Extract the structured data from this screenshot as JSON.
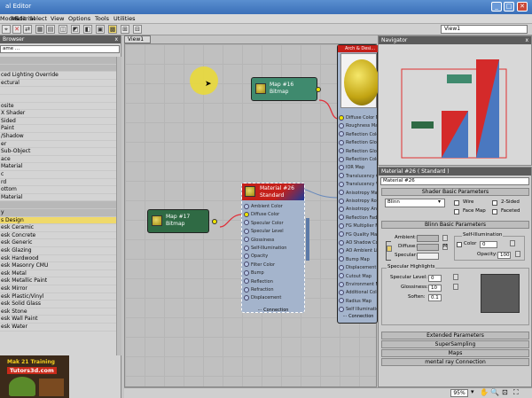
{
  "window": {
    "title": "al Editor",
    "min": "_",
    "max": "□",
    "close": "✕"
  },
  "menu": [
    "Modes",
    "Material",
    "Edit",
    "Select",
    "View",
    "Options",
    "Tools",
    "Utilities"
  ],
  "toolbar": {
    "view_select": "View1"
  },
  "browser": {
    "title": "Browser",
    "close": "x",
    "search": "ame ...",
    "items": [
      {
        "label": "",
        "group": true
      },
      {
        "label": "",
        "group": true
      },
      {
        "label": "ced Lighting Override",
        "group": false
      },
      {
        "label": "ectural",
        "group": false
      },
      {
        "label": "",
        "group": false
      },
      {
        "label": "",
        "group": false
      },
      {
        "label": "osite",
        "group": false
      },
      {
        "label": "X Shader",
        "group": false
      },
      {
        "label": "Sided",
        "group": false
      },
      {
        "label": "Paint",
        "group": false
      },
      {
        "label": "/Shadow",
        "group": false
      },
      {
        "label": "er",
        "group": false
      },
      {
        "label": "Sub-Object",
        "group": false
      },
      {
        "label": "ace",
        "group": false
      },
      {
        "label": "Material",
        "group": false
      },
      {
        "label": "c",
        "group": false
      },
      {
        "label": "rd",
        "group": false
      },
      {
        "label": "ottom",
        "group": false
      },
      {
        "label": "Material",
        "group": false
      },
      {
        "label": "",
        "group": true
      },
      {
        "label": "y",
        "group": true
      },
      {
        "label": "s Design",
        "selected": true
      },
      {
        "label": "esk Ceramic"
      },
      {
        "label": "esk Concrete"
      },
      {
        "label": "esk Generic"
      },
      {
        "label": "esk Glazing"
      },
      {
        "label": "esk Hardwood"
      },
      {
        "label": "esk Masonry CMU"
      },
      {
        "label": "esk Metal"
      },
      {
        "label": "esk Metallic Paint"
      },
      {
        "label": "esk Mirror"
      },
      {
        "label": "esk Plastic/Vinyl"
      },
      {
        "label": "esk Solid Glass"
      },
      {
        "label": "esk Stone"
      },
      {
        "label": "esk Wall Paint"
      },
      {
        "label": "esk Water"
      }
    ],
    "logo": {
      "line1": "Mak 21 Training",
      "line2": "Tutors3d.com"
    }
  },
  "view": {
    "tab": "View1",
    "node_map16": {
      "title": "Map #16",
      "sub": "Bitmap"
    },
    "node_map17": {
      "title": "Map #17",
      "sub": "Bitmap"
    },
    "node_material": {
      "title": "Material #26",
      "sub": "Standard",
      "slots": [
        "Ambient Color",
        "Diffuse Color",
        "Specular Color",
        "Specular Level",
        "Glossiness",
        "Self-Illumination",
        "Opacity",
        "Filter Color",
        "Bump",
        "Reflection",
        "Refraction",
        "Displacement"
      ],
      "footer": "⋯ Connection"
    },
    "node_right": {
      "header": "Arch & Desi...",
      "slots": [
        "Diffuse Color M...",
        "Roughness Map",
        "Reflection Colo...",
        "Reflection Glos...",
        "Reflection Glos...",
        "Reflection Colo...",
        "IOR Map",
        "Translucency Co...",
        "Translucency W...",
        "Anisotropy Map",
        "Anisotropy Rota...",
        "Anisotropy Angl...",
        "Reflection Fade...",
        "FG Multiplier Map",
        "FG Quality Map",
        "AO Shadow Co...",
        "AO Ambient Lig...",
        "Bump Map",
        "Displacement M...",
        "Cutout Map",
        "Environment M...",
        "Additional Colo...",
        "Radius Map",
        "Self Illumination"
      ],
      "footer": "⋯ Connection"
    }
  },
  "navigator": {
    "title": "Navigator"
  },
  "material_panel": {
    "title": "Material #26 ( Standard )",
    "name": "Material #26",
    "rollouts": {
      "shader_basic": "Shader Basic Parameters",
      "blinn_basic": "Blinn Basic Parameters",
      "extended": "Extended Parameters",
      "supersampling": "SuperSampling",
      "maps": "Maps",
      "mental_ray": "mental ray Connection"
    },
    "shader": "Blinn",
    "checks": {
      "wire": "Wire",
      "two_sided": "2-Sided",
      "face_map": "Face Map",
      "faceted": "Faceted"
    },
    "self_illum": {
      "title": "Self-Illumination",
      "color": "Color",
      "value": "0"
    },
    "labels": {
      "ambient": "Ambient:",
      "diffuse": "Diffuse:",
      "specular": "Specular:",
      "opacity": "Opacity:",
      "m": "M"
    },
    "opacity_value": "100",
    "highlights": {
      "title": "Specular Highlights",
      "spec_level_label": "Specular Level:",
      "spec_level": "0",
      "glossiness_label": "Glossiness:",
      "glossiness": "10",
      "soften_label": "Soften:",
      "soften": "0.1"
    }
  },
  "status": {
    "zoom": "95%"
  }
}
